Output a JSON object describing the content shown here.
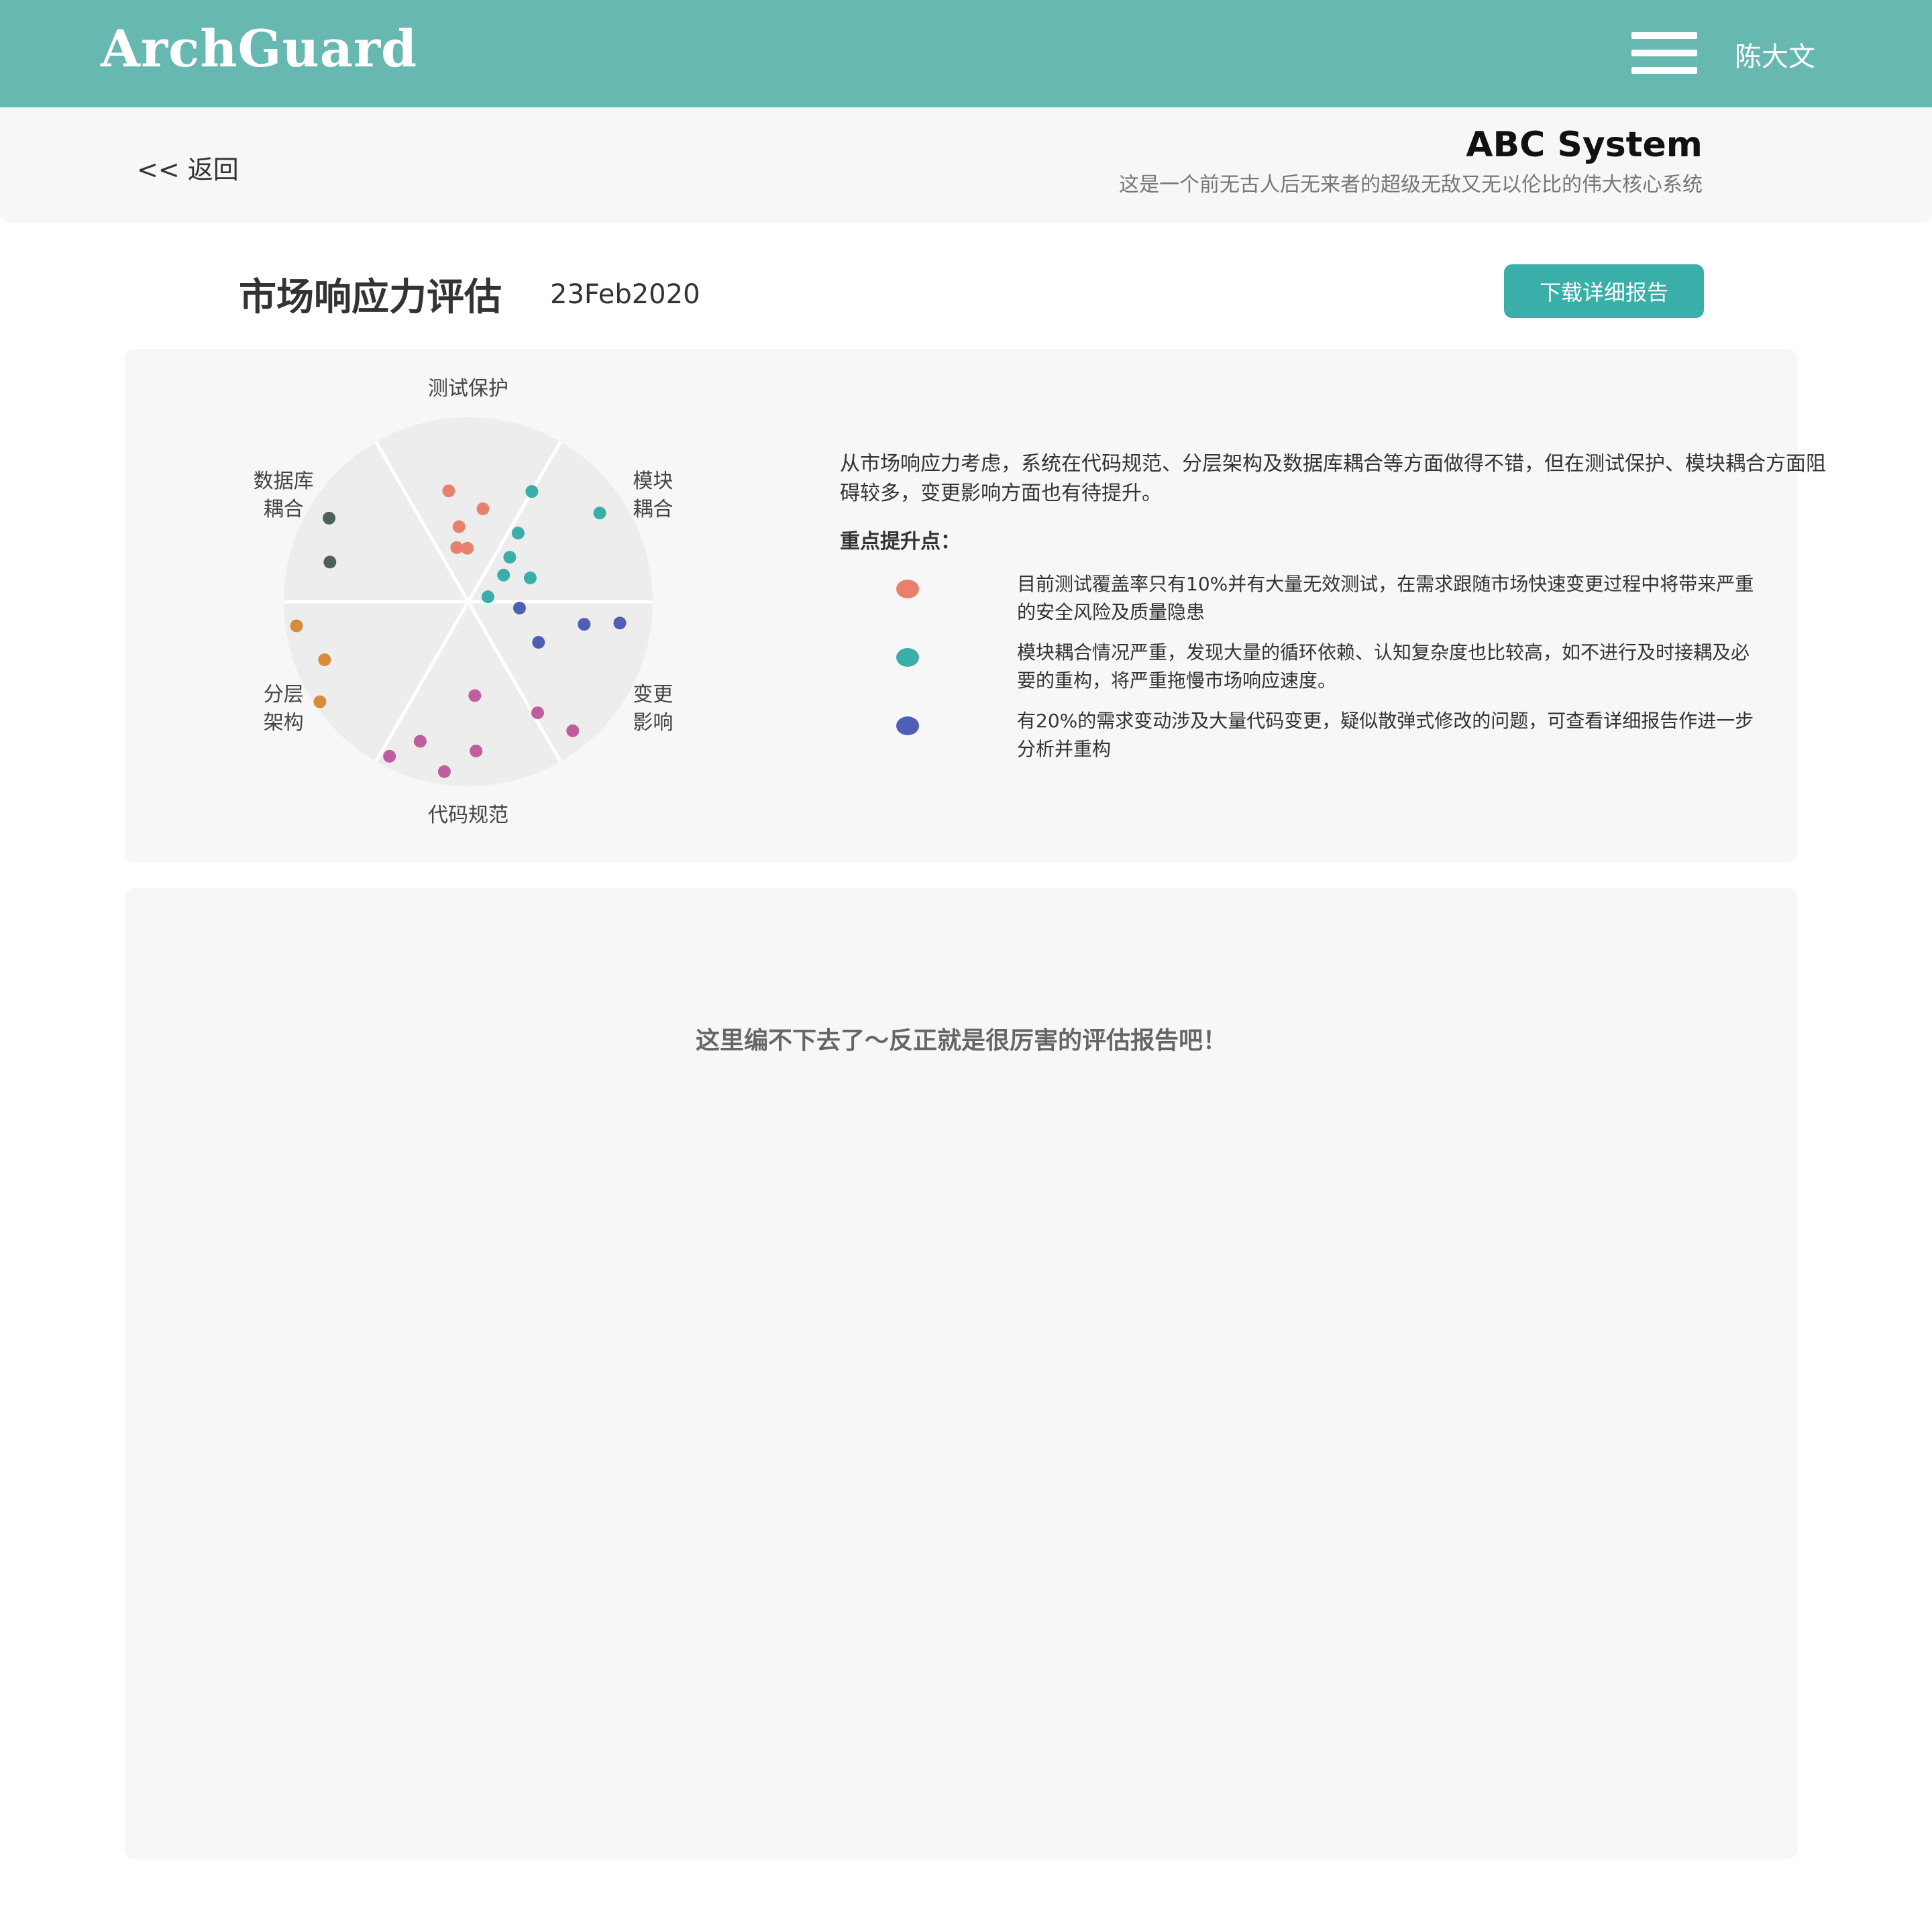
{
  "header": {
    "logo": "ArchGuard",
    "menu_icon": "hamburger-menu-icon",
    "user_name": "陈大文"
  },
  "subheader": {
    "back_label": "<< 返回",
    "system_title": "ABC System",
    "system_desc": "这是一个前无古人后无来者的超级无敌又无以伦比的伟大核心系统"
  },
  "page": {
    "title": "市场响应力评估",
    "date": "23Feb2020",
    "download_label": "下载详细报告"
  },
  "chart_data": {
    "type": "scatter",
    "title": "",
    "chart_form": "radial sectors (6)",
    "background_color": "#ededed",
    "sectors": [
      {
        "label": "测试保护",
        "color": "#e8806e",
        "angle_deg": -90
      },
      {
        "label": "模块\n耦合",
        "color": "#3aafa9",
        "angle_deg": -30
      },
      {
        "label": "变更\n影响",
        "color": "#4f5fb3",
        "angle_deg": 30
      },
      {
        "label": "代码规范",
        "color": "#be5e9e",
        "angle_deg": 90
      },
      {
        "label": "分层\n架构",
        "color": "#d98a3a",
        "angle_deg": 150
      },
      {
        "label": "数据库\n耦合",
        "color": "#4f6157",
        "angle_deg": 210
      }
    ],
    "points": [
      {
        "sector": "测试保护",
        "angle_deg": -100,
        "r": 0.61
      },
      {
        "sector": "测试保护",
        "angle_deg": -81,
        "r": 0.51
      },
      {
        "sector": "测试保护",
        "angle_deg": -97,
        "r": 0.41
      },
      {
        "sector": "测试保护",
        "angle_deg": -102,
        "r": 0.3
      },
      {
        "sector": "测试保护",
        "angle_deg": -91,
        "r": 0.29
      },
      {
        "sector": "模块耦合",
        "angle_deg": -60,
        "r": 0.69
      },
      {
        "sector": "模块耦合",
        "angle_deg": -34,
        "r": 0.86
      },
      {
        "sector": "模块耦合",
        "angle_deg": -54,
        "r": 0.46
      },
      {
        "sector": "模块耦合",
        "angle_deg": -47,
        "r": 0.33
      },
      {
        "sector": "模块耦合",
        "angle_deg": -37,
        "r": 0.24
      },
      {
        "sector": "模块耦合",
        "angle_deg": -21,
        "r": 0.36
      },
      {
        "sector": "模块耦合",
        "angle_deg": -14,
        "r": 0.11
      },
      {
        "sector": "变更影响",
        "angle_deg": 7,
        "r": 0.28
      },
      {
        "sector": "变更影响",
        "angle_deg": 11,
        "r": 0.64
      },
      {
        "sector": "变更影响",
        "angle_deg": 8,
        "r": 0.83
      },
      {
        "sector": "变更影响",
        "angle_deg": 30,
        "r": 0.44
      },
      {
        "sector": "代码规范",
        "angle_deg": 86,
        "r": 0.51
      },
      {
        "sector": "代码规范",
        "angle_deg": 58,
        "r": 0.71
      },
      {
        "sector": "代码规范",
        "angle_deg": 51,
        "r": 0.9
      },
      {
        "sector": "代码规范",
        "angle_deg": 87,
        "r": 0.81
      },
      {
        "sector": "代码规范",
        "angle_deg": 98,
        "r": 0.93
      },
      {
        "sector": "代码规范",
        "angle_deg": 109,
        "r": 0.8
      },
      {
        "sector": "代码规范",
        "angle_deg": 117,
        "r": 0.94
      },
      {
        "sector": "分层架构",
        "angle_deg": 172,
        "r": 0.94
      },
      {
        "sector": "分层架构",
        "angle_deg": 158,
        "r": 0.84
      },
      {
        "sector": "分层架构",
        "angle_deg": 146,
        "r": 0.97
      },
      {
        "sector": "数据库耦合",
        "angle_deg": 211,
        "r": 0.88
      },
      {
        "sector": "数据库耦合",
        "angle_deg": 196,
        "r": 0.78
      }
    ]
  },
  "summary": {
    "text": "从市场响应力考虑，系统在代码规范、分层架构及数据库耦合等方面做得不错，但在测试保护、模块耦合方面阻碍较多，变更影响方面也有待提升。",
    "key_title": "重点提升点：",
    "points": [
      {
        "color": "#e8806e",
        "text": "目前测试覆盖率只有10%并有大量无效测试，在需求跟随市场快速变更过程中将带来严重的安全风险及质量隐患"
      },
      {
        "color": "#3aafa9",
        "text": "模块耦合情况严重，发现大量的循环依赖、认知复杂度也比较高，如不进行及时接耦及必要的重构，将严重拖慢市场响应速度。"
      },
      {
        "color": "#4f5fb3",
        "text": "有20%的需求变动涉及大量代码变更，疑似散弹式修改的问题，可查看详细报告作进一步分析并重构"
      }
    ]
  },
  "report": {
    "placeholder": "这里编不下去了～反正就是很厉害的评估报告吧！"
  }
}
